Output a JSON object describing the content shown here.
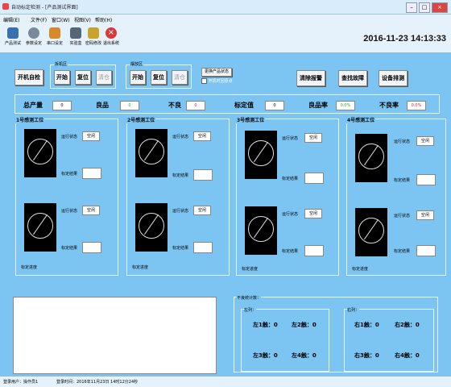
{
  "window": {
    "title": "自动标定检测 - [产品测试界面]"
  },
  "menu": [
    "编辑(E)",
    "文件(F)",
    "窗口(W)",
    "视图(V)",
    "帮助(H)"
  ],
  "toolbar": {
    "items": [
      {
        "label": "产品测试",
        "color": "#3a6fb0"
      },
      {
        "label": "参数设定",
        "color": "#7b8a99"
      },
      {
        "label": "串口设定",
        "color": "#d68a2a"
      },
      {
        "label": "实验盒",
        "color": "#556677"
      },
      {
        "label": "密码修改",
        "color": "#c9a42a"
      },
      {
        "label": "退出系统",
        "color": "#d83a3a"
      }
    ],
    "datetime": "2016-11-23 14:13:33"
  },
  "controls": {
    "power_on_check": "开机自检",
    "left_group_label": "拆机区",
    "right_group_label": "摆放区",
    "start": "开始",
    "reset": "复位",
    "clear": "清仓",
    "change_product": "更换产品状态",
    "auto_return_label": "开机时回原点",
    "clear_alarm": "清除报警",
    "find_fault": "查找故障",
    "device_debug": "设备排测"
  },
  "stats": {
    "total_label": "总产量",
    "total": "0",
    "good_label": "良品",
    "good": "0",
    "bad_label": "不良",
    "bad": "0",
    "nominal_label": "标定值",
    "nominal": "0",
    "good_rate_label": "良品率",
    "good_rate": "0.0%",
    "bad_rate_label": "不良率",
    "bad_rate": "0.0%"
  },
  "stations": [
    {
      "title": "1号感测工位"
    },
    {
      "title": "2号感测工位"
    },
    {
      "title": "3号感测工位"
    },
    {
      "title": "4号感测工位"
    }
  ],
  "station_labels": {
    "run_state": "运行状态",
    "idle": "空闲",
    "calib_result": "标定结果",
    "calib_progress": "标定进度"
  },
  "bad_stats": {
    "title": "不良统计数：",
    "left_title": "左列：",
    "right_title": "右列：",
    "left": [
      "左1触：0",
      "左2触：0",
      "左3触：0",
      "左4触：0"
    ],
    "right": [
      "右1触：0",
      "右2触：0",
      "右3触：0",
      "右4触：0"
    ]
  },
  "status": {
    "user": "登录用户：操作员1",
    "login_time": "登录时间：2016年11月23日 14时12分24秒"
  }
}
